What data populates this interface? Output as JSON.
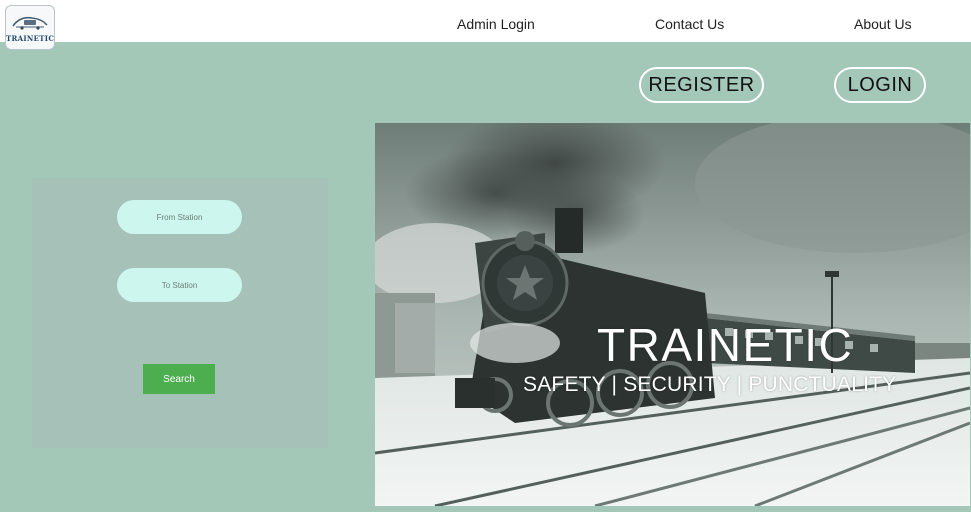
{
  "brand": {
    "logo_text": "TRAINETIC",
    "logo_icon": "train-logo-icon"
  },
  "nav": {
    "admin_login": "Admin Login",
    "contact_us": "Contact Us",
    "about_us": "About Us"
  },
  "auth": {
    "register": "REGISTER",
    "login": "LOGIN"
  },
  "search": {
    "from_placeholder": "From Station",
    "to_placeholder": "To Station",
    "button": "Search"
  },
  "hero": {
    "title": "TRAINETIC",
    "tagline": "SAFETY | SECURITY | PUNCTUALITY",
    "image": "steam-locomotive-snow-photo"
  },
  "colors": {
    "page_bg": "#a3c8b8",
    "panel_bg": "#a6c2b8",
    "input_bg": "#ccf6ee",
    "search_button": "#4cae4f",
    "topbar": "#ffffff"
  }
}
